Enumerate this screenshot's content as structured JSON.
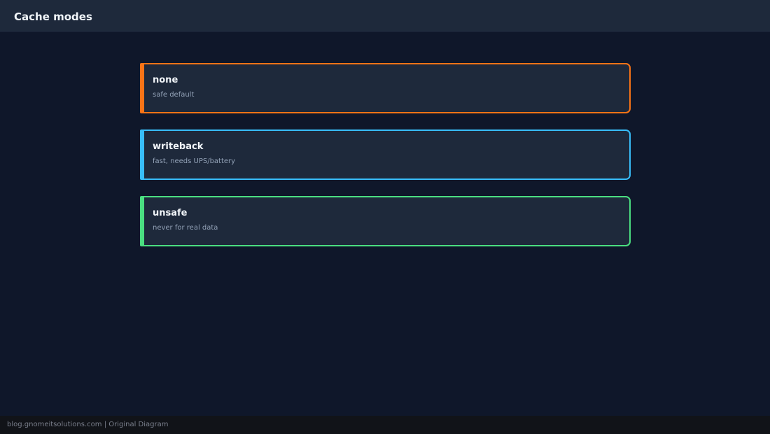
{
  "header": {
    "title": "Cache modes"
  },
  "modes": [
    {
      "name": "none",
      "description": "safe default",
      "color": "#f97316"
    },
    {
      "name": "writeback",
      "description": "fast, needs UPS/battery",
      "color": "#38bdf8"
    },
    {
      "name": "unsafe",
      "description": "never for real data",
      "color": "#4ade80"
    }
  ],
  "footer": {
    "credit": "blog.gnomeitsolutions.com | Original Diagram"
  }
}
